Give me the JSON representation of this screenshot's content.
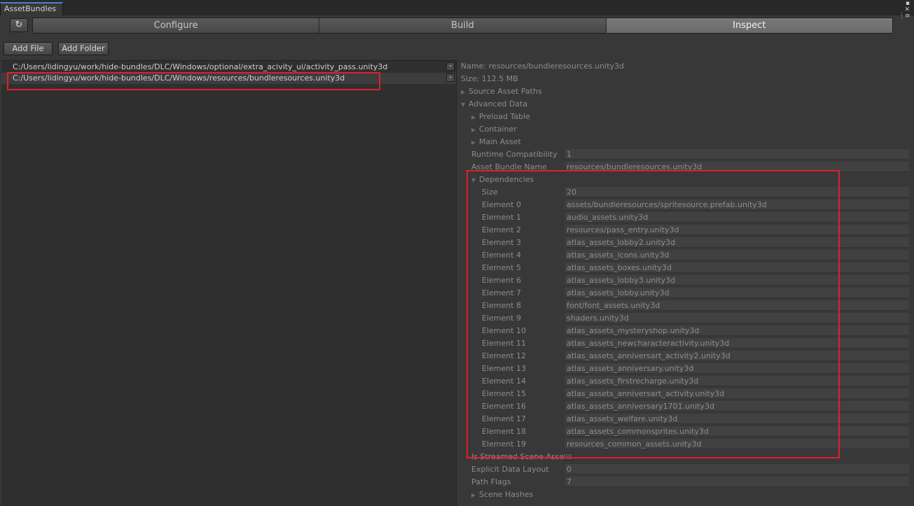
{
  "window": {
    "tab_title": "AssetBundles"
  },
  "toolbar": {
    "refresh_icon": "↻",
    "modes": [
      "Configure",
      "Build",
      "Inspect"
    ],
    "active_mode": "Inspect",
    "add_file": "Add File",
    "add_folder": "Add Folder"
  },
  "bundle_list": [
    {
      "path": "C:/Users/lidingyu/work/hide-bundles/DLC/Windows/optional/extra_acivity_ui/activity_pass.unity3d",
      "selected": false
    },
    {
      "path": "C:/Users/lidingyu/work/hide-bundles/DLC/Windows/resources/bundleresources.unity3d",
      "selected": true
    }
  ],
  "inspector": {
    "name_line": "Name: resources/bundleresources.unity3d",
    "size_line": "Size: 112.5 MB",
    "source_asset_paths": "Source Asset Paths",
    "advanced_data": "Advanced Data",
    "preload_table": "Preload Table",
    "container": "Container",
    "main_asset": "Main Asset",
    "runtime_compat_label": "Runtime Compatibility",
    "runtime_compat_value": "1",
    "bundle_name_label": "Asset Bundle Name",
    "bundle_name_value": "resources/bundleresources.unity3d",
    "dependencies_label": "Dependencies",
    "dep_size_label": "Size",
    "dep_size_value": "20",
    "dependencies": [
      {
        "label": "Element 0",
        "value": "assets/bundleresources/spritesource.prefab.unity3d"
      },
      {
        "label": "Element 1",
        "value": "audio_assets.unity3d"
      },
      {
        "label": "Element 2",
        "value": "resources/pass_entry.unity3d"
      },
      {
        "label": "Element 3",
        "value": "atlas_assets_lobby2.unity3d"
      },
      {
        "label": "Element 4",
        "value": "atlas_assets_icons.unity3d"
      },
      {
        "label": "Element 5",
        "value": "atlas_assets_boxes.unity3d"
      },
      {
        "label": "Element 6",
        "value": "atlas_assets_lobby3.unity3d"
      },
      {
        "label": "Element 7",
        "value": "atlas_assets_lobby.unity3d"
      },
      {
        "label": "Element 8",
        "value": "font/font_assets.unity3d"
      },
      {
        "label": "Element 9",
        "value": "shaders.unity3d"
      },
      {
        "label": "Element 10",
        "value": "atlas_assets_mysteryshop.unity3d"
      },
      {
        "label": "Element 11",
        "value": "atlas_assets_newcharacteractivity.unity3d"
      },
      {
        "label": "Element 12",
        "value": "atlas_assets_anniversart_activity2.unity3d"
      },
      {
        "label": "Element 13",
        "value": "atlas_assets_anniversary.unity3d"
      },
      {
        "label": "Element 14",
        "value": "atlas_assets_firstrecharge.unity3d"
      },
      {
        "label": "Element 15",
        "value": "atlas_assets_anniversart_activity.unity3d"
      },
      {
        "label": "Element 16",
        "value": "atlas_assets_anniversary1701.unity3d"
      },
      {
        "label": "Element 17",
        "value": "atlas_assets_welfare.unity3d"
      },
      {
        "label": "Element 18",
        "value": "atlas_assets_commonsprites.unity3d"
      },
      {
        "label": "Element 19",
        "value": "resources_common_assets.unity3d"
      }
    ],
    "streamed_label": "Is Streamed Scene AssetBundle",
    "explicit_layout_label": "Explicit Data Layout",
    "explicit_layout_value": "0",
    "path_flags_label": "Path Flags",
    "path_flags_value": "7",
    "scene_hashes": "Scene Hashes"
  },
  "colors": {
    "highlight": "#e0202a",
    "tab_accent": "#4a7fd0"
  }
}
